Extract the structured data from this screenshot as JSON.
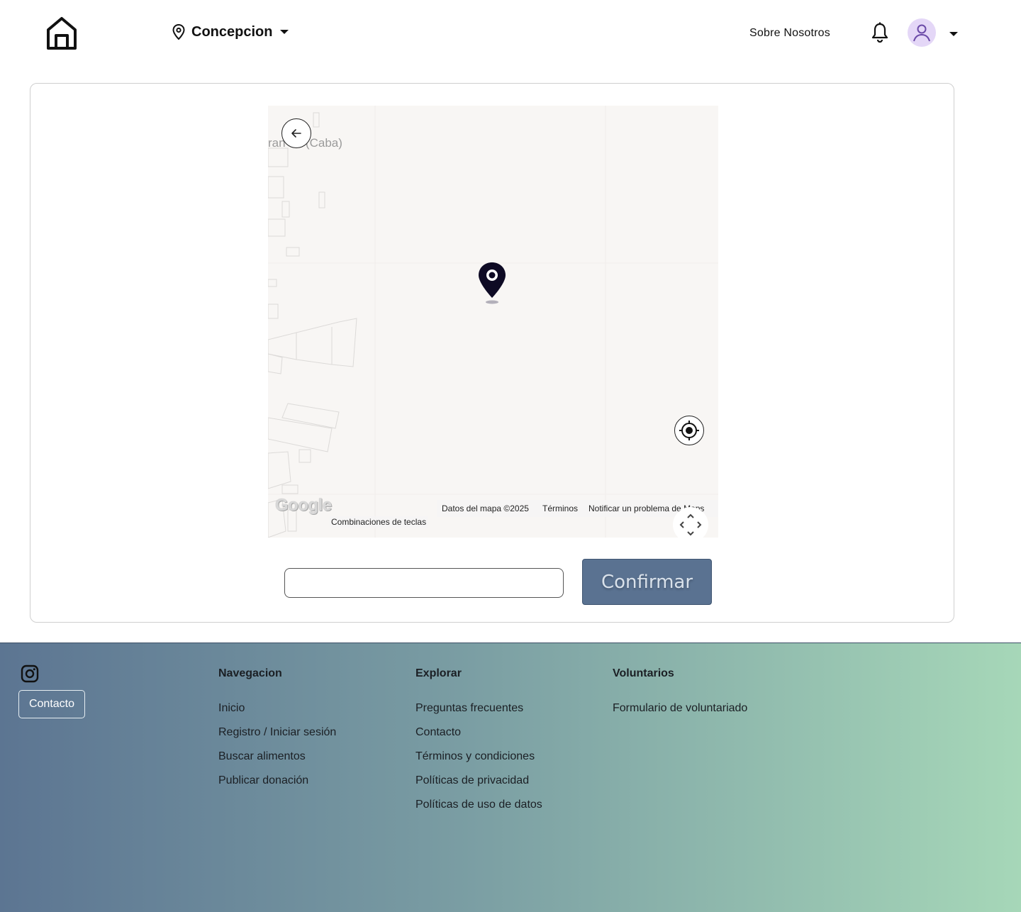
{
  "header": {
    "location": "Concepcion",
    "about_label": "Sobre Nosotros"
  },
  "map": {
    "street_label": "ran 38 (Caba)",
    "attribution": {
      "map_data": "Datos del mapa ©2025",
      "terms": "Términos",
      "report": "Notificar un problema de Maps",
      "shortcuts": "Combinaciones de teclas"
    },
    "google_logo": "Google"
  },
  "form": {
    "address_value": "",
    "confirm_label": "Confirmar"
  },
  "footer": {
    "contact_button": "Contacto",
    "columns": [
      {
        "title": "Navegacion",
        "links": [
          "Inicio",
          "Registro / Iniciar sesión",
          "Buscar alimentos",
          "Publicar donación"
        ]
      },
      {
        "title": "Explorar",
        "links": [
          "Preguntas frecuentes",
          "Contacto",
          "Términos y condiciones",
          "Políticas de privacidad",
          "Políticas de uso de datos"
        ]
      },
      {
        "title": "Voluntarios",
        "links": [
          "Formulario de voluntariado"
        ]
      }
    ]
  },
  "icons": {
    "logo": "home-icon",
    "location": "map-pin-icon",
    "notifications": "bell-icon",
    "user": "user-icon",
    "back": "arrow-left-icon",
    "locate": "crosshair-icon",
    "pan": "move-icon",
    "social": "instagram-icon"
  },
  "colors": {
    "confirm_button": "#5a7291",
    "avatar_bg": "#e4d7f7",
    "footer_gradient_start": "#5c7592",
    "footer_gradient_end": "#a6d7b8"
  }
}
